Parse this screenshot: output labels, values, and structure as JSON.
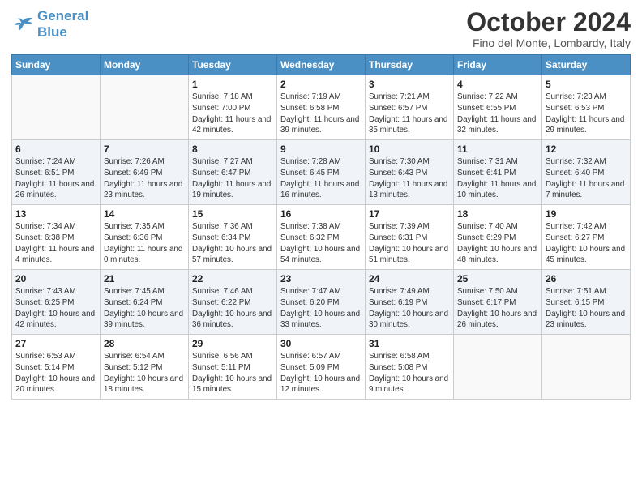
{
  "header": {
    "logo_line1": "General",
    "logo_line2": "Blue",
    "month": "October 2024",
    "location": "Fino del Monte, Lombardy, Italy"
  },
  "days_of_week": [
    "Sunday",
    "Monday",
    "Tuesday",
    "Wednesday",
    "Thursday",
    "Friday",
    "Saturday"
  ],
  "weeks": [
    {
      "shaded": false,
      "days": [
        {
          "num": "",
          "info": ""
        },
        {
          "num": "",
          "info": ""
        },
        {
          "num": "1",
          "info": "Sunrise: 7:18 AM\nSunset: 7:00 PM\nDaylight: 11 hours and 42 minutes."
        },
        {
          "num": "2",
          "info": "Sunrise: 7:19 AM\nSunset: 6:58 PM\nDaylight: 11 hours and 39 minutes."
        },
        {
          "num": "3",
          "info": "Sunrise: 7:21 AM\nSunset: 6:57 PM\nDaylight: 11 hours and 35 minutes."
        },
        {
          "num": "4",
          "info": "Sunrise: 7:22 AM\nSunset: 6:55 PM\nDaylight: 11 hours and 32 minutes."
        },
        {
          "num": "5",
          "info": "Sunrise: 7:23 AM\nSunset: 6:53 PM\nDaylight: 11 hours and 29 minutes."
        }
      ]
    },
    {
      "shaded": true,
      "days": [
        {
          "num": "6",
          "info": "Sunrise: 7:24 AM\nSunset: 6:51 PM\nDaylight: 11 hours and 26 minutes."
        },
        {
          "num": "7",
          "info": "Sunrise: 7:26 AM\nSunset: 6:49 PM\nDaylight: 11 hours and 23 minutes."
        },
        {
          "num": "8",
          "info": "Sunrise: 7:27 AM\nSunset: 6:47 PM\nDaylight: 11 hours and 19 minutes."
        },
        {
          "num": "9",
          "info": "Sunrise: 7:28 AM\nSunset: 6:45 PM\nDaylight: 11 hours and 16 minutes."
        },
        {
          "num": "10",
          "info": "Sunrise: 7:30 AM\nSunset: 6:43 PM\nDaylight: 11 hours and 13 minutes."
        },
        {
          "num": "11",
          "info": "Sunrise: 7:31 AM\nSunset: 6:41 PM\nDaylight: 11 hours and 10 minutes."
        },
        {
          "num": "12",
          "info": "Sunrise: 7:32 AM\nSunset: 6:40 PM\nDaylight: 11 hours and 7 minutes."
        }
      ]
    },
    {
      "shaded": false,
      "days": [
        {
          "num": "13",
          "info": "Sunrise: 7:34 AM\nSunset: 6:38 PM\nDaylight: 11 hours and 4 minutes."
        },
        {
          "num": "14",
          "info": "Sunrise: 7:35 AM\nSunset: 6:36 PM\nDaylight: 11 hours and 0 minutes."
        },
        {
          "num": "15",
          "info": "Sunrise: 7:36 AM\nSunset: 6:34 PM\nDaylight: 10 hours and 57 minutes."
        },
        {
          "num": "16",
          "info": "Sunrise: 7:38 AM\nSunset: 6:32 PM\nDaylight: 10 hours and 54 minutes."
        },
        {
          "num": "17",
          "info": "Sunrise: 7:39 AM\nSunset: 6:31 PM\nDaylight: 10 hours and 51 minutes."
        },
        {
          "num": "18",
          "info": "Sunrise: 7:40 AM\nSunset: 6:29 PM\nDaylight: 10 hours and 48 minutes."
        },
        {
          "num": "19",
          "info": "Sunrise: 7:42 AM\nSunset: 6:27 PM\nDaylight: 10 hours and 45 minutes."
        }
      ]
    },
    {
      "shaded": true,
      "days": [
        {
          "num": "20",
          "info": "Sunrise: 7:43 AM\nSunset: 6:25 PM\nDaylight: 10 hours and 42 minutes."
        },
        {
          "num": "21",
          "info": "Sunrise: 7:45 AM\nSunset: 6:24 PM\nDaylight: 10 hours and 39 minutes."
        },
        {
          "num": "22",
          "info": "Sunrise: 7:46 AM\nSunset: 6:22 PM\nDaylight: 10 hours and 36 minutes."
        },
        {
          "num": "23",
          "info": "Sunrise: 7:47 AM\nSunset: 6:20 PM\nDaylight: 10 hours and 33 minutes."
        },
        {
          "num": "24",
          "info": "Sunrise: 7:49 AM\nSunset: 6:19 PM\nDaylight: 10 hours and 30 minutes."
        },
        {
          "num": "25",
          "info": "Sunrise: 7:50 AM\nSunset: 6:17 PM\nDaylight: 10 hours and 26 minutes."
        },
        {
          "num": "26",
          "info": "Sunrise: 7:51 AM\nSunset: 6:15 PM\nDaylight: 10 hours and 23 minutes."
        }
      ]
    },
    {
      "shaded": false,
      "days": [
        {
          "num": "27",
          "info": "Sunrise: 6:53 AM\nSunset: 5:14 PM\nDaylight: 10 hours and 20 minutes."
        },
        {
          "num": "28",
          "info": "Sunrise: 6:54 AM\nSunset: 5:12 PM\nDaylight: 10 hours and 18 minutes."
        },
        {
          "num": "29",
          "info": "Sunrise: 6:56 AM\nSunset: 5:11 PM\nDaylight: 10 hours and 15 minutes."
        },
        {
          "num": "30",
          "info": "Sunrise: 6:57 AM\nSunset: 5:09 PM\nDaylight: 10 hours and 12 minutes."
        },
        {
          "num": "31",
          "info": "Sunrise: 6:58 AM\nSunset: 5:08 PM\nDaylight: 10 hours and 9 minutes."
        },
        {
          "num": "",
          "info": ""
        },
        {
          "num": "",
          "info": ""
        }
      ]
    }
  ]
}
